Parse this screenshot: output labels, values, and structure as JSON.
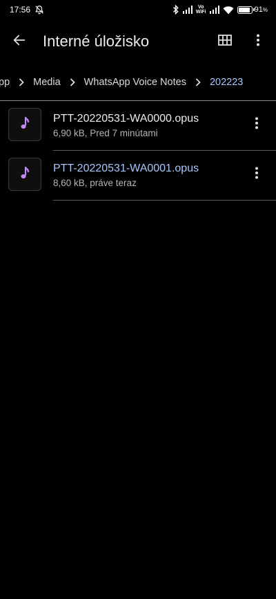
{
  "status_bar": {
    "time": "17:56",
    "volte_top": "Vo",
    "volte_bottom": "WiFi",
    "battery_percent": "91",
    "battery_unit": "%",
    "battery_level": 0.91
  },
  "app_bar": {
    "title": "Interné úložisko",
    "back_icon": "arrow-left-icon",
    "view_icon": "grid-view-icon",
    "more_icon": "more-vert-icon"
  },
  "breadcrumb": {
    "items": [
      {
        "label": "pp"
      },
      {
        "label": "Media"
      },
      {
        "label": "WhatsApp Voice Notes"
      },
      {
        "label": "202223"
      }
    ]
  },
  "files": [
    {
      "name": "PTT-20220531-WA0000.opus",
      "meta": "6,90 kB, Pred 7 minútami",
      "icon": "audio-file-icon"
    },
    {
      "name": "PTT-20220531-WA0001.opus",
      "meta": "8,60 kB, práve teraz",
      "icon": "audio-file-icon"
    }
  ],
  "colors": {
    "background": "#000000",
    "accent": "#a8c7fa",
    "audio_icon": "#c58af9"
  }
}
